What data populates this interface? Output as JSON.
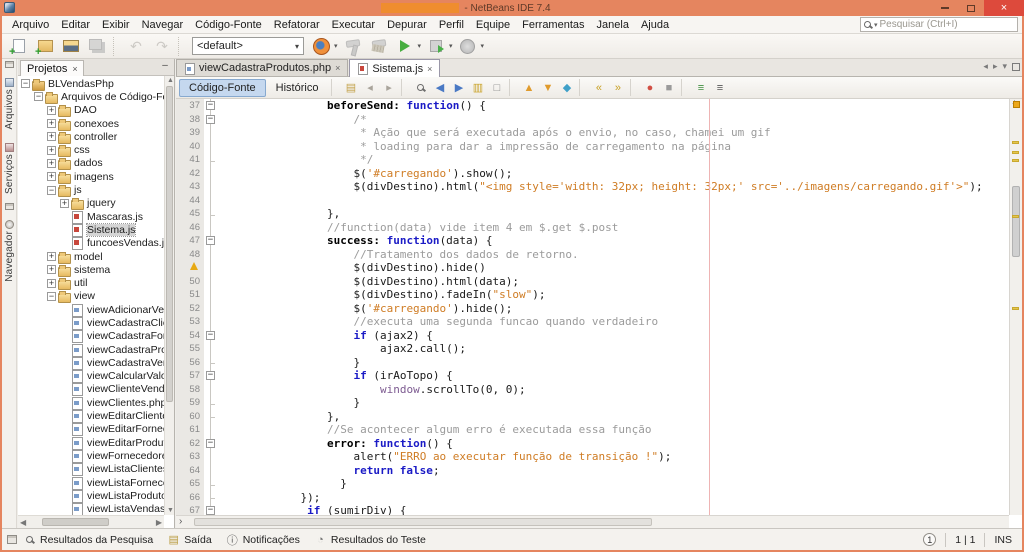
{
  "window": {
    "title": "- NetBeans IDE 7.4",
    "accent": "#e5855f",
    "close_color": "#dd4a3c"
  },
  "titlebar": {
    "close": "×"
  },
  "menubar": {
    "items": [
      "Arquivo",
      "Editar",
      "Exibir",
      "Navegar",
      "Código-Fonte",
      "Refatorar",
      "Executar",
      "Depurar",
      "Perfil",
      "Equipe",
      "Ferramentas",
      "Janela",
      "Ajuda"
    ]
  },
  "search": {
    "placeholder": "Pesquisar (Ctrl+I)"
  },
  "toolbar": {
    "items": [
      {
        "type": "icon",
        "name": "new-file"
      },
      {
        "type": "icon",
        "name": "new-project"
      },
      {
        "type": "icon",
        "name": "open-project"
      },
      {
        "type": "icon",
        "name": "save-all",
        "disabled": true
      },
      {
        "type": "sep"
      },
      {
        "type": "icon",
        "name": "undo",
        "glyph": "↶",
        "disabled": true
      },
      {
        "type": "icon",
        "name": "redo",
        "glyph": "↷",
        "disabled": true
      },
      {
        "type": "sep"
      },
      {
        "type": "combo",
        "name": "configuration-combo",
        "value": "<default>"
      },
      {
        "type": "icon",
        "name": "browser-firefox",
        "dropdown": true
      },
      {
        "type": "icon",
        "name": "build",
        "disabled": true
      },
      {
        "type": "icon",
        "name": "clean-build",
        "disabled": true
      },
      {
        "type": "icon",
        "name": "run",
        "dropdown": true
      },
      {
        "type": "icon",
        "name": "debug",
        "dropdown": true
      },
      {
        "type": "icon",
        "name": "profile",
        "dropdown": true
      }
    ]
  },
  "dock_left": {
    "items": [
      {
        "type": "mini",
        "name": "dock-restore-group-top"
      },
      {
        "type": "tab",
        "label": "Arquivos",
        "icon": "files"
      },
      {
        "type": "tab",
        "label": "Serviços",
        "icon": "services"
      },
      {
        "type": "mini",
        "name": "dock-restore-group-mid"
      },
      {
        "type": "tab",
        "label": "Navegador",
        "icon": "navigator"
      }
    ]
  },
  "projects_panel": {
    "tab_label": "Projetos",
    "close_glyph": "×",
    "minimize_glyph": "–",
    "tree": [
      {
        "label": "BLVendasPhp",
        "level": 0,
        "exp": "open",
        "icon": "project"
      },
      {
        "label": "Arquivos de Código-Fonte",
        "level": 1,
        "exp": "open",
        "icon": "srcfolder"
      },
      {
        "label": "DAO",
        "level": 2,
        "exp": "closed",
        "icon": "folder"
      },
      {
        "label": "conexoes",
        "level": 2,
        "exp": "closed",
        "icon": "folder"
      },
      {
        "label": "controller",
        "level": 2,
        "exp": "closed",
        "icon": "folder"
      },
      {
        "label": "css",
        "level": 2,
        "exp": "closed",
        "icon": "folder"
      },
      {
        "label": "dados",
        "level": 2,
        "exp": "closed",
        "icon": "folder"
      },
      {
        "label": "imagens",
        "level": 2,
        "exp": "closed",
        "icon": "folder"
      },
      {
        "label": "js",
        "level": 2,
        "exp": "open",
        "icon": "folder"
      },
      {
        "label": "jquery",
        "level": 3,
        "exp": "closed",
        "icon": "folder"
      },
      {
        "label": "Mascaras.js",
        "level": 3,
        "icon": "js"
      },
      {
        "label": "Sistema.js",
        "level": 3,
        "icon": "js",
        "selected": true
      },
      {
        "label": "funcoesVendas.js",
        "level": 3,
        "icon": "js"
      },
      {
        "label": "model",
        "level": 2,
        "exp": "closed",
        "icon": "folder"
      },
      {
        "label": "sistema",
        "level": 2,
        "exp": "closed",
        "icon": "folder"
      },
      {
        "label": "util",
        "level": 2,
        "exp": "closed",
        "icon": "folder"
      },
      {
        "label": "view",
        "level": 2,
        "exp": "open",
        "icon": "folder"
      },
      {
        "label": "viewAdicionarVend",
        "level": 3,
        "icon": "php"
      },
      {
        "label": "viewCadastraClien",
        "level": 3,
        "icon": "php"
      },
      {
        "label": "viewCadastraForn",
        "level": 3,
        "icon": "php"
      },
      {
        "label": "viewCadastraProd",
        "level": 3,
        "icon": "php"
      },
      {
        "label": "viewCadastraVend",
        "level": 3,
        "icon": "php"
      },
      {
        "label": "viewCalcularValor",
        "level": 3,
        "icon": "php"
      },
      {
        "label": "viewClienteVenda",
        "level": 3,
        "icon": "php"
      },
      {
        "label": "viewClientes.php",
        "level": 3,
        "icon": "php"
      },
      {
        "label": "viewEditarClientes",
        "level": 3,
        "icon": "php"
      },
      {
        "label": "viewEditarFornece",
        "level": 3,
        "icon": "php"
      },
      {
        "label": "viewEditarProduto",
        "level": 3,
        "icon": "php"
      },
      {
        "label": "viewFornecedores",
        "level": 3,
        "icon": "php"
      },
      {
        "label": "viewListaClientes.",
        "level": 3,
        "icon": "php"
      },
      {
        "label": "viewListaFornece",
        "level": 3,
        "icon": "php"
      },
      {
        "label": "viewListaProdutos",
        "level": 3,
        "icon": "php"
      },
      {
        "label": "viewListaVendas.p",
        "level": 3,
        "icon": "php"
      }
    ]
  },
  "editor": {
    "tabs": [
      {
        "label": "viewCadastraProdutos.php",
        "icon": "php",
        "active": false,
        "close": "×"
      },
      {
        "label": "Sistema.js",
        "icon": "js",
        "active": true,
        "close": "×"
      }
    ],
    "tab_controls": [
      {
        "name": "scroll-tabs-left",
        "glyph": "◂"
      },
      {
        "name": "scroll-tabs-right",
        "glyph": "▸"
      },
      {
        "name": "opened-documents-list",
        "glyph": "▾"
      },
      {
        "name": "maximize-editor",
        "glyph": "box"
      }
    ],
    "toolbar": {
      "buttons": [
        {
          "label": "Código-Fonte",
          "active": true
        },
        {
          "label": "Histórico",
          "active": false
        }
      ],
      "icon_groups": [
        [
          {
            "name": "last-edit",
            "glyph": "▤",
            "color": "#c3a24a"
          },
          {
            "name": "back",
            "glyph": "◂",
            "color": "#a9a49b"
          },
          {
            "name": "forward",
            "glyph": "▸",
            "color": "#a9a49b"
          }
        ],
        [
          {
            "name": "find-selection",
            "glyph": "mag"
          },
          {
            "name": "find-previous-occurrence",
            "glyph": "◀",
            "color": "#4a79c4"
          },
          {
            "name": "find-next-occurrence",
            "glyph": "▶",
            "color": "#4a79c4"
          },
          {
            "name": "toggle-highlight-search",
            "glyph": "▥",
            "color": "#c9a227"
          },
          {
            "name": "toggle-rectangular-selection",
            "glyph": "□",
            "color": "#8a8a8a"
          }
        ],
        [
          {
            "name": "previous-bookmark",
            "glyph": "▲",
            "color": "#e09b2d"
          },
          {
            "name": "next-bookmark",
            "glyph": "▼",
            "color": "#e09b2d"
          },
          {
            "name": "toggle-bookmark",
            "glyph": "◆",
            "color": "#3fa0c8"
          }
        ],
        [
          {
            "name": "shift-line-left",
            "glyph": "«",
            "color": "#c9a227"
          },
          {
            "name": "shift-line-right",
            "glyph": "»",
            "color": "#c9a227"
          }
        ],
        [
          {
            "name": "start-macro-recording",
            "glyph": "●",
            "color": "#d14f44"
          },
          {
            "name": "stop-macro-recording",
            "glyph": "■",
            "color": "#9a9a9a"
          }
        ],
        [
          {
            "name": "comment",
            "glyph": "≡",
            "color": "#3f8f3f"
          },
          {
            "name": "uncomment",
            "glyph": "≡",
            "color": "#555555"
          }
        ]
      ]
    },
    "code": {
      "language": "javascript",
      "lines": [
        {
          "n": 37,
          "ind": 16,
          "f": "b",
          "t": [
            [
              "prop",
              "beforeSend:"
            ],
            [
              "pl",
              " "
            ],
            [
              "kw",
              "function"
            ],
            [
              "pl",
              "() {"
            ]
          ]
        },
        {
          "n": 38,
          "ind": 20,
          "f": "b",
          "t": [
            [
              "cm",
              "/*"
            ]
          ]
        },
        {
          "n": 39,
          "ind": 21,
          "f": "l",
          "t": [
            [
              "cm",
              "* Ação que será executada após o envio, no caso, chamei um gif"
            ]
          ]
        },
        {
          "n": 40,
          "ind": 21,
          "f": "l",
          "t": [
            [
              "cm",
              "* loading para dar a impressão de carregamento na página"
            ]
          ]
        },
        {
          "n": 41,
          "ind": 21,
          "f": "e",
          "t": [
            [
              "cm",
              "*/"
            ]
          ]
        },
        {
          "n": 42,
          "ind": 20,
          "f": "l",
          "t": [
            [
              "pl",
              "$("
            ],
            [
              "str",
              "'#carregando'"
            ],
            [
              "pl",
              ").show();"
            ]
          ]
        },
        {
          "n": 43,
          "ind": 20,
          "f": "l",
          "t": [
            [
              "pl",
              "$(divDestino).html("
            ],
            [
              "str",
              "\"<img style='width: 32px; height: 32px;' src='../imagens/carregando.gif'>\""
            ],
            [
              "pl",
              ");"
            ]
          ]
        },
        {
          "n": 44,
          "ind": 0,
          "f": "l",
          "t": []
        },
        {
          "n": 45,
          "ind": 16,
          "f": "e",
          "t": [
            [
              "pl",
              "},"
            ]
          ]
        },
        {
          "n": 46,
          "ind": 16,
          "f": "l",
          "t": [
            [
              "cm",
              "//function(data) vide item 4 em $.get $.post"
            ]
          ]
        },
        {
          "n": 47,
          "ind": 16,
          "f": "b",
          "t": [
            [
              "prop",
              "success:"
            ],
            [
              "pl",
              " "
            ],
            [
              "kw",
              "function"
            ],
            [
              "pl",
              "(data) {"
            ]
          ]
        },
        {
          "n": 48,
          "ind": 20,
          "f": "l",
          "t": [
            [
              "cm",
              "//Tratamento dos dados de retorno."
            ]
          ]
        },
        {
          "n": 49,
          "ind": 20,
          "f": "l",
          "w": true,
          "t": [
            [
              "pl",
              "$(divDestino).hide()"
            ]
          ]
        },
        {
          "n": 50,
          "ind": 20,
          "f": "l",
          "t": [
            [
              "pl",
              "$(divDestino).html(data);"
            ]
          ]
        },
        {
          "n": 51,
          "ind": 20,
          "f": "l",
          "t": [
            [
              "pl",
              "$(divDestino).fadeIn("
            ],
            [
              "str",
              "\"slow\""
            ],
            [
              "pl",
              ");"
            ]
          ]
        },
        {
          "n": 52,
          "ind": 20,
          "f": "l",
          "t": [
            [
              "pl",
              "$("
            ],
            [
              "str",
              "'#carregando'"
            ],
            [
              "pl",
              ").hide();"
            ]
          ]
        },
        {
          "n": 53,
          "ind": 20,
          "f": "l",
          "t": [
            [
              "cm",
              "//executa uma segunda funcao quando verdadeiro"
            ]
          ]
        },
        {
          "n": 54,
          "ind": 20,
          "f": "b",
          "t": [
            [
              "kw",
              "if"
            ],
            [
              "pl",
              " (ajax2) {"
            ]
          ]
        },
        {
          "n": 55,
          "ind": 24,
          "f": "l",
          "t": [
            [
              "pl",
              "ajax2.call();"
            ]
          ]
        },
        {
          "n": 56,
          "ind": 20,
          "f": "e",
          "t": [
            [
              "pl",
              "}"
            ]
          ]
        },
        {
          "n": 57,
          "ind": 20,
          "f": "b",
          "t": [
            [
              "kw",
              "if"
            ],
            [
              "pl",
              " (irAoTopo) {"
            ]
          ]
        },
        {
          "n": 58,
          "ind": 24,
          "f": "l",
          "t": [
            [
              "glob",
              "window"
            ],
            [
              "pl",
              ".scrollTo(0, 0);"
            ]
          ]
        },
        {
          "n": 59,
          "ind": 20,
          "f": "e",
          "t": [
            [
              "pl",
              "}"
            ]
          ]
        },
        {
          "n": 60,
          "ind": 16,
          "f": "e",
          "t": [
            [
              "pl",
              "},"
            ]
          ]
        },
        {
          "n": 61,
          "ind": 16,
          "f": "l",
          "t": [
            [
              "cm",
              "//Se acontecer algum erro é executada essa função"
            ]
          ]
        },
        {
          "n": 62,
          "ind": 16,
          "f": "b",
          "t": [
            [
              "prop",
              "error:"
            ],
            [
              "pl",
              " "
            ],
            [
              "kw",
              "function"
            ],
            [
              "pl",
              "() {"
            ]
          ]
        },
        {
          "n": 63,
          "ind": 20,
          "f": "l",
          "t": [
            [
              "pl",
              "alert("
            ],
            [
              "str",
              "\"ERRO ao executar função de transição !\""
            ],
            [
              "pl",
              ");"
            ]
          ]
        },
        {
          "n": 64,
          "ind": 20,
          "f": "l",
          "t": [
            [
              "kw",
              "return false"
            ],
            [
              "pl",
              ";"
            ]
          ]
        },
        {
          "n": 65,
          "ind": 18,
          "f": "e",
          "t": [
            [
              "pl",
              "}"
            ]
          ]
        },
        {
          "n": 66,
          "ind": 12,
          "f": "e",
          "t": [
            [
              "pl",
              "});"
            ]
          ]
        },
        {
          "n": 67,
          "ind": 13,
          "f": "b",
          "t": [
            [
              "kw",
              "if"
            ],
            [
              "pl",
              " (sumirDiv) {"
            ]
          ]
        }
      ]
    },
    "error_stripe": {
      "top_status": "warnings-present",
      "marks_pct": [
        10,
        12.5,
        14.5,
        28,
        50
      ]
    }
  },
  "statusbar": {
    "left_items": [
      {
        "label": "Resultados da Pesquisa",
        "icon": "search",
        "glyph": ""
      },
      {
        "label": "Saída",
        "icon": "output",
        "glyph": "▤"
      },
      {
        "label": "Notificações",
        "icon": "info",
        "glyph": "ⓘ"
      },
      {
        "label": "Resultados do Teste",
        "icon": "test",
        "glyph": "◔"
      }
    ],
    "right": {
      "badge": "1",
      "caret": "1 | 1",
      "mode": "INS"
    }
  }
}
